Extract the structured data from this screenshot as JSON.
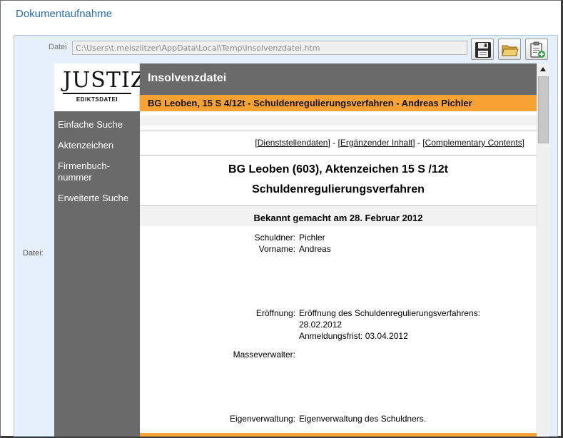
{
  "dialog": {
    "title": "Dokumentaufnahme"
  },
  "file": {
    "label_top": "Datei",
    "path": "C:\\Users\\t.meiszlitzer\\AppData\\Local\\Temp\\Insolvenzdatei.htm",
    "label_side": "Datei:"
  },
  "logo": {
    "text": "JUSTIZ",
    "subtitle": "EDIKTSDATEI"
  },
  "sidebar": {
    "items": [
      {
        "label": "Einfache Suche"
      },
      {
        "label": "Aktenzeichen"
      },
      {
        "label": "Firmenbuch-"
      },
      {
        "label": "nummer"
      },
      {
        "label": "Erweiterte Suche"
      }
    ]
  },
  "page": {
    "header_title": "Insolvenzdatei",
    "case_banner": "BG Leoben, 15 S 4/12t - Schuldenregulierungsverfahren - Andreas Pichler",
    "links": {
      "dienststelle": "Dienststellendaten",
      "ergaenzend": "Ergänzender Inhalt",
      "complementary": "Complementary Contents",
      "sep": " - "
    },
    "heading_court": "BG Leoben (603), Aktenzeichen 15 S   /12t",
    "heading_proc": "Schuldenregulierungsverfahren",
    "announced": "Bekannt gemacht am 28. Februar 2012",
    "fields": {
      "schuldner_label": "Schuldner:",
      "schuldner_value": "Pichler",
      "vorname_label": "Vorname:",
      "vorname_value": "Andreas",
      "eroeffnung_label": "Eröffnung:",
      "eroeffnung_line1": "Eröffnung des Schuldenregulierungsverfahrens:",
      "eroeffnung_line2": "28.02.2012",
      "eroeffnung_line3": "Anmeldungsfrist: 03.04.2012",
      "masseverwalter_label": "Masseverwalter:",
      "eigenverwaltung_label": "Eigenverwaltung:",
      "eigenverwaltung_value": "Eigenverwaltung des Schuldners."
    }
  },
  "icons": {
    "save": "floppy-disk-icon",
    "open": "folder-icon",
    "paste": "clipboard-add-icon"
  }
}
